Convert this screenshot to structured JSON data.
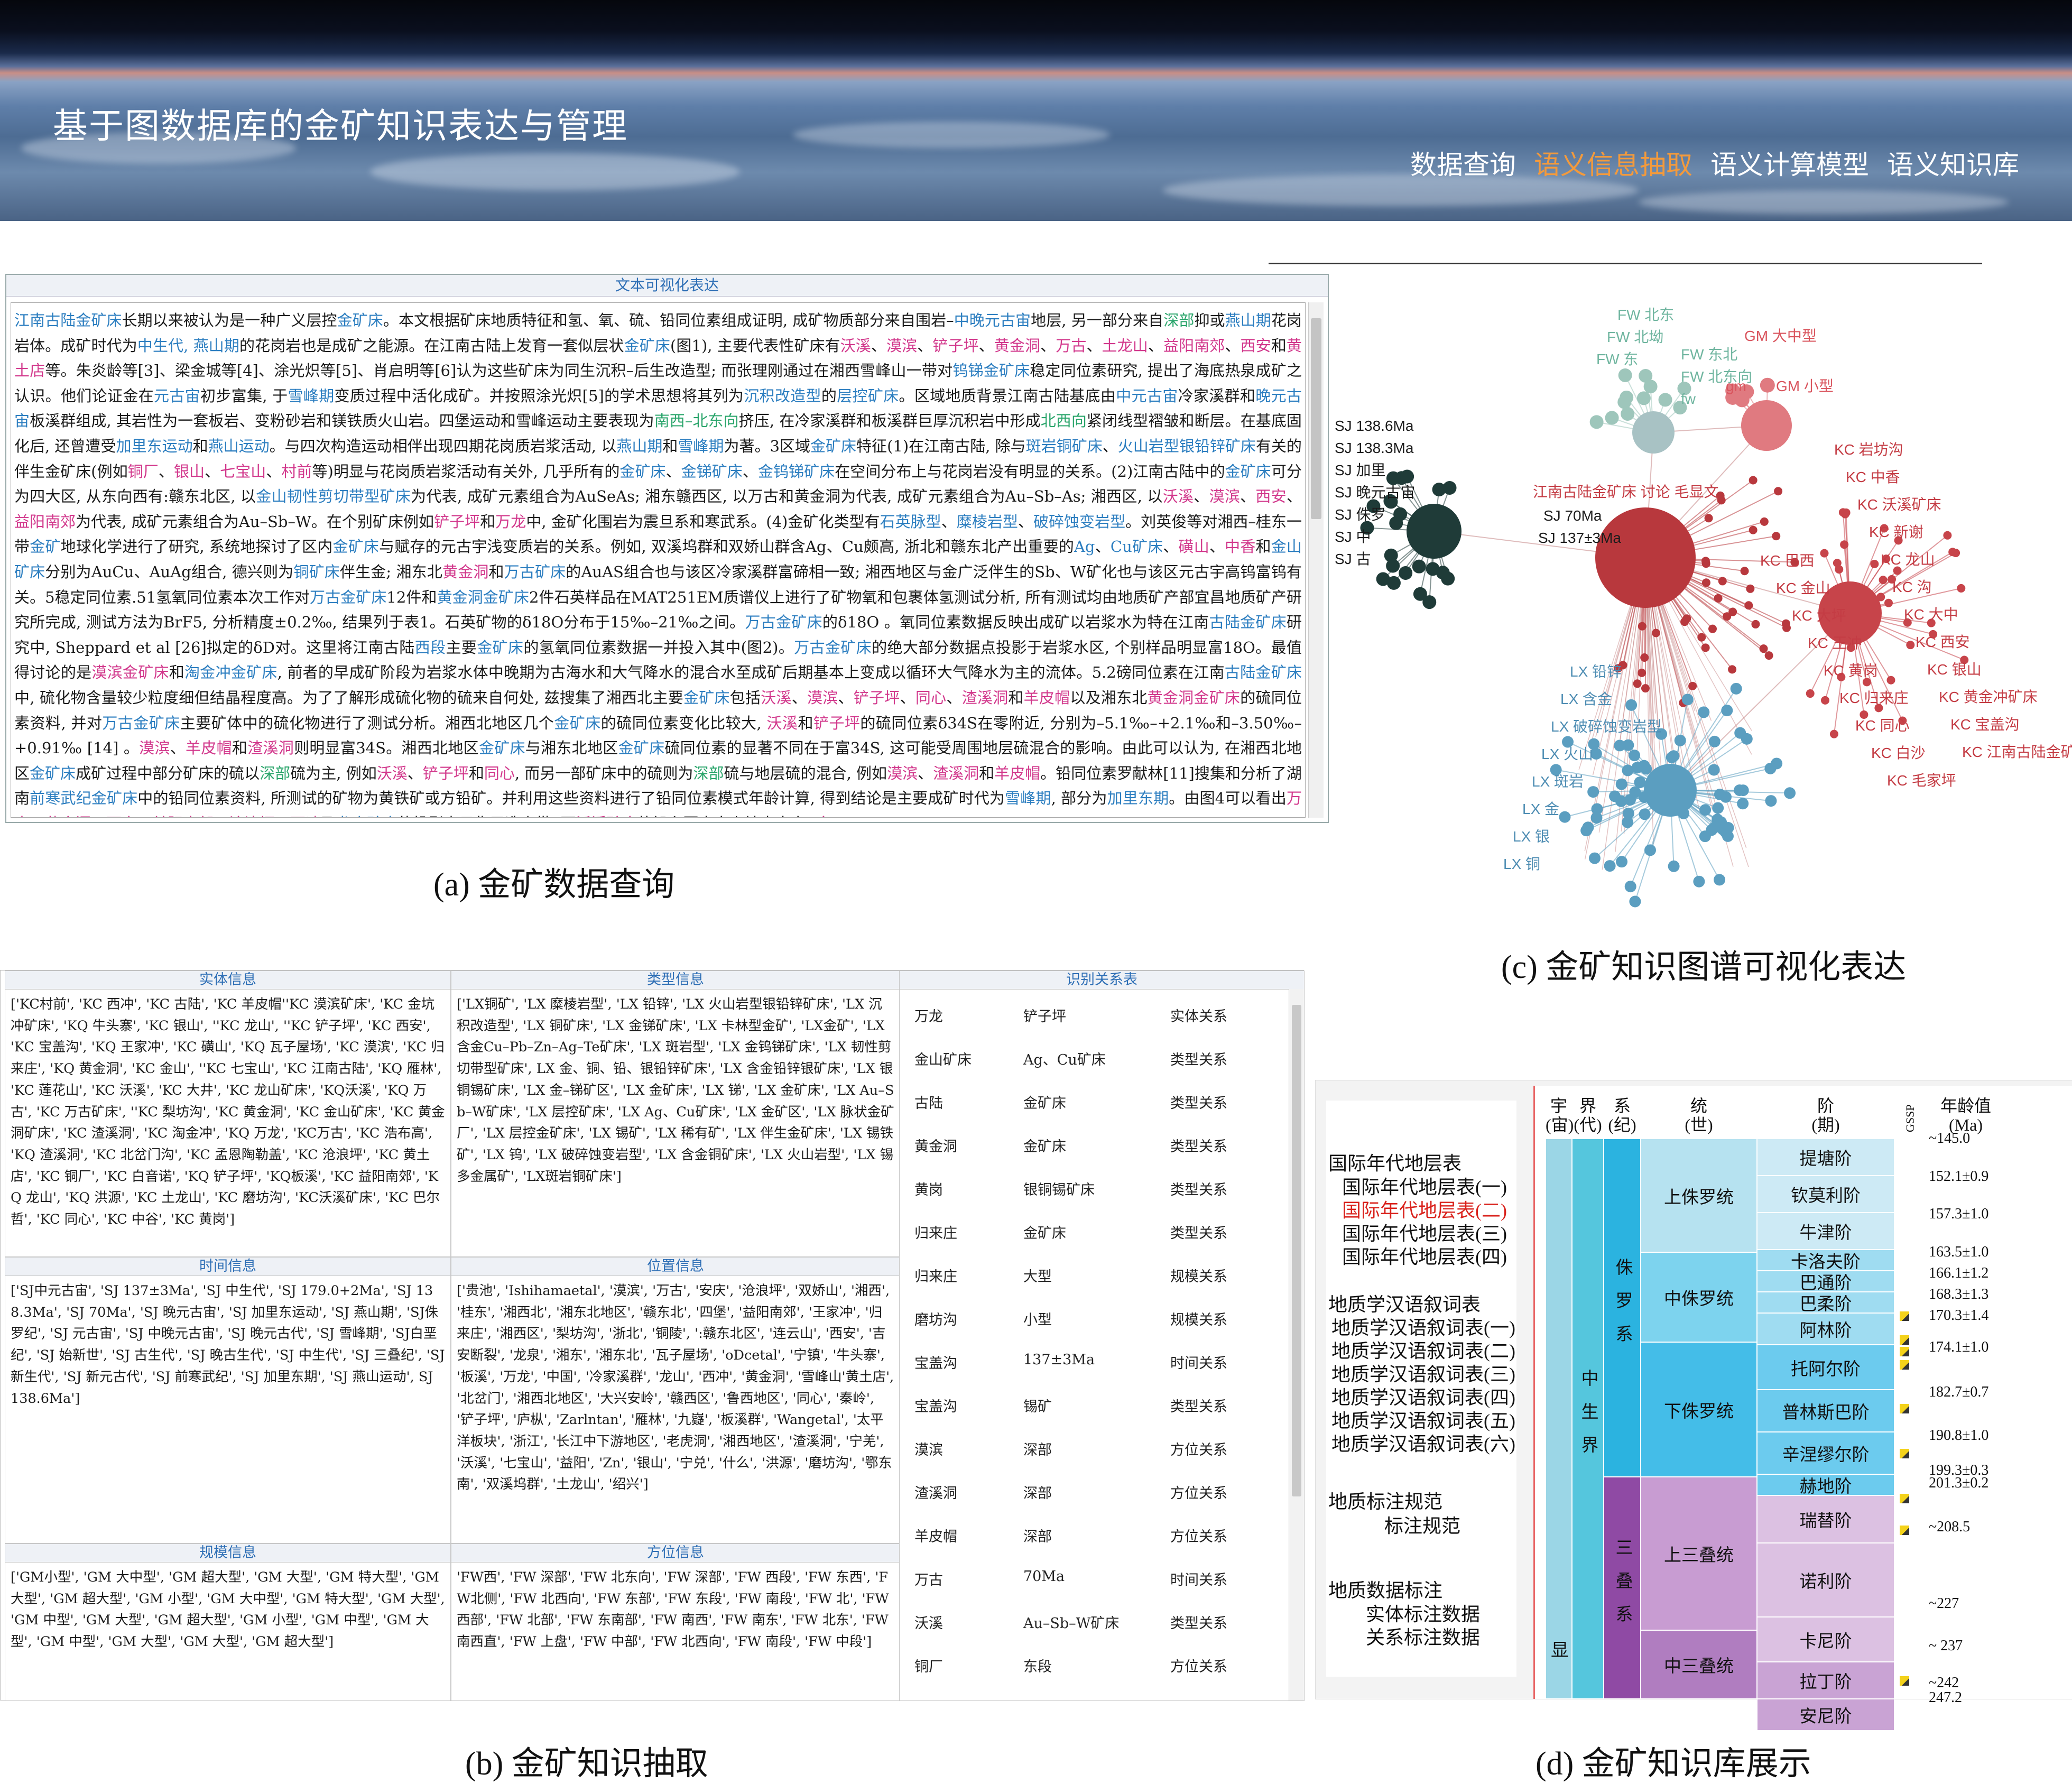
{
  "banner": {
    "title": "基于图数据库的金矿知识表达与管理",
    "nav": [
      "数据查询",
      "语义信息抽取",
      "语义计算模型",
      "语义知识库"
    ],
    "active_nav": "语义信息抽取",
    "active_color": "#f39a3c"
  },
  "captions": {
    "a": "(a) 金矿数据查询",
    "b": "(b) 金矿知识抽取",
    "c": "(c) 金矿知识图谱可视化表达",
    "d": "(d) 金矿知识库展示"
  },
  "panel_a": {
    "header": "文本可视化表达",
    "paragraph": [
      {
        "c": "b",
        "t": "江南古陆金矿床"
      },
      {
        "t": "长期以来被认为是一种广义层控"
      },
      {
        "c": "b",
        "t": "金矿床"
      },
      {
        "t": "。本文根据矿床地质特征和氢、氧、硫、铅同位素组成证明, 成矿物质部分来自围岩–"
      },
      {
        "c": "b",
        "t": "中晚元古宙"
      },
      {
        "t": "地层, 另一部分来自"
      },
      {
        "c": "g",
        "t": "深部"
      },
      {
        "t": "抑或"
      },
      {
        "c": "b",
        "t": "燕山期"
      },
      {
        "t": "花岗岩体。成矿时代为"
      },
      {
        "c": "b",
        "t": "中生代, 燕山期"
      },
      {
        "t": "的花岗岩也是成矿之能源。在江南古陆上发育一套似层状"
      },
      {
        "c": "b",
        "t": "金矿床"
      },
      {
        "t": "(图1), 主要代表性矿床有"
      },
      {
        "c": "p",
        "t": "沃溪"
      },
      {
        "t": "、"
      },
      {
        "c": "p",
        "t": "漠滨"
      },
      {
        "t": "、"
      },
      {
        "c": "p",
        "t": "铲子坪"
      },
      {
        "t": "、"
      },
      {
        "c": "p",
        "t": "黄金洞"
      },
      {
        "t": "、"
      },
      {
        "c": "p",
        "t": "万古"
      },
      {
        "t": "、"
      },
      {
        "c": "p",
        "t": "土龙山"
      },
      {
        "t": "、"
      },
      {
        "c": "p",
        "t": "益阳南郊"
      },
      {
        "t": "、"
      },
      {
        "c": "p",
        "t": "西安"
      },
      {
        "t": "和"
      },
      {
        "c": "p",
        "t": "黄土店"
      },
      {
        "t": "等。朱炎龄等[3]、梁金城等[4]、涂光炽等[5]、肖启明等[6]认为这些矿床为同生沉积–后生改造型; 而张理刚通过在湘西雪峰山一带对"
      },
      {
        "c": "b",
        "t": "钨锑金矿床"
      },
      {
        "t": "稳定同位素研究, 提出了海底热泉成矿之认识。他们论证金在"
      },
      {
        "c": "b",
        "t": "元古宙"
      },
      {
        "t": "初步富集, 于"
      },
      {
        "c": "b",
        "t": "雪峰期"
      },
      {
        "t": "变质过程中活化成矿。并按照涂光炽[5]的学术思想将其列为"
      },
      {
        "c": "b",
        "t": "沉积改造型"
      },
      {
        "t": "的"
      },
      {
        "c": "b",
        "t": "层控矿床"
      },
      {
        "t": "。区域地质背景江南古陆基底由"
      },
      {
        "c": "b",
        "t": "中元古宙"
      },
      {
        "t": "冷家溪群和"
      },
      {
        "c": "b",
        "t": "晚元古宙"
      },
      {
        "t": "板溪群组成, 其岩性为一套板岩、变粉砂岩和镁铁质火山岩。四堡运动和雪峰运动主要表现为"
      },
      {
        "c": "g",
        "t": "南西–北东向"
      },
      {
        "t": "挤压, 在冷家溪群和板溪群巨厚沉积岩中形成"
      },
      {
        "c": "g",
        "t": "北西向"
      },
      {
        "t": "紧闭线型褶皱和断层。在基底固化后, 还曾遭受"
      },
      {
        "c": "b",
        "t": "加里东运动"
      },
      {
        "t": "和"
      },
      {
        "c": "b",
        "t": "燕山运动"
      },
      {
        "t": "。与四次构造运动相伴出现四期花岗质岩浆活动, 以"
      },
      {
        "c": "b",
        "t": "燕山期"
      },
      {
        "t": "和"
      },
      {
        "c": "b",
        "t": "雪峰期"
      },
      {
        "t": "为著。3区域"
      },
      {
        "c": "b",
        "t": "金矿床"
      },
      {
        "t": "特征(1)在江南古陆, 除与"
      },
      {
        "c": "b",
        "t": "斑岩铜矿床"
      },
      {
        "t": "、"
      },
      {
        "c": "b",
        "t": "火山岩型银铅锌矿床"
      },
      {
        "t": "有关的伴生金矿床(例如"
      },
      {
        "c": "p",
        "t": "铜厂"
      },
      {
        "t": "、"
      },
      {
        "c": "p",
        "t": "银山"
      },
      {
        "t": "、"
      },
      {
        "c": "p",
        "t": "七宝山"
      },
      {
        "t": "、"
      },
      {
        "c": "p",
        "t": "村前"
      },
      {
        "t": "等)明显与花岗质岩浆活动有关外, 几乎所有的"
      },
      {
        "c": "b",
        "t": "金矿床"
      },
      {
        "t": "、"
      },
      {
        "c": "b",
        "t": "金锑矿床"
      },
      {
        "t": "、"
      },
      {
        "c": "b",
        "t": "金钨锑矿床"
      },
      {
        "t": "在空间分布上与花岗岩没有明显的关系。(2)江南古陆中的"
      },
      {
        "c": "b",
        "t": "金矿床"
      },
      {
        "t": "可分为四大区, 从东向西有:赣东北区, 以"
      },
      {
        "c": "b",
        "t": "金山韧性剪切带型矿床"
      },
      {
        "t": "为代表, 成矿元素组合为AuSeAs; 湘东赣西区, 以万古和黄金洞为代表, 成矿元素组合为Au–Sb–As; 湘西区, 以"
      },
      {
        "c": "p",
        "t": "沃溪"
      },
      {
        "t": "、"
      },
      {
        "c": "p",
        "t": "漠滨"
      },
      {
        "t": "、"
      },
      {
        "c": "p",
        "t": "西安"
      },
      {
        "t": "、"
      },
      {
        "c": "p",
        "t": "益阳南郊"
      },
      {
        "t": "为代表, 成矿元素组合为Au–Sb–W。在个别矿床例如"
      },
      {
        "c": "p",
        "t": "铲子坪"
      },
      {
        "t": "和"
      },
      {
        "c": "p",
        "t": "万龙"
      },
      {
        "t": "中, 金矿化围岩为震旦系和寒武系。(4)金矿化类型有"
      },
      {
        "c": "b",
        "t": "石英脉型"
      },
      {
        "t": "、"
      },
      {
        "c": "b",
        "t": "糜棱岩型"
      },
      {
        "t": "、"
      },
      {
        "c": "b",
        "t": "破碎蚀变岩型"
      },
      {
        "t": "。刘英俊等对湘西–桂东一带"
      },
      {
        "c": "b",
        "t": "金矿"
      },
      {
        "t": "地球化学进行了研究, 系统地探讨了区内"
      },
      {
        "c": "b",
        "t": "金矿床"
      },
      {
        "t": "与赋存的元古宇浅变质岩的关系。例如, 双溪坞群和双娇山群含Ag、Cu颇高, 浙北和赣东北产出重要的"
      },
      {
        "c": "b",
        "t": "Ag"
      },
      {
        "t": "、"
      },
      {
        "c": "b",
        "t": "Cu矿床"
      },
      {
        "t": "、"
      },
      {
        "c": "p",
        "t": "磺山"
      },
      {
        "t": "、"
      },
      {
        "c": "p",
        "t": "中香"
      },
      {
        "t": "和"
      },
      {
        "c": "b",
        "t": "金山矿床"
      },
      {
        "t": "分别为AuCu、AuAg组合, 德兴则为"
      },
      {
        "c": "b",
        "t": "铜矿床"
      },
      {
        "t": "伴生金; 湘东北"
      },
      {
        "c": "p",
        "t": "黄金洞"
      },
      {
        "t": "和"
      },
      {
        "c": "b",
        "t": "万古矿床"
      },
      {
        "t": "的AuAS组合也与该区冷家溪群富碲相一致; 湘西地区与金广泛伴生的Sb、W矿化也与该区元古宇高钨富钨有关。5稳定同位素.51氢氧同位素本次工作对"
      },
      {
        "c": "b",
        "t": "万古金矿床"
      },
      {
        "t": "12件和"
      },
      {
        "c": "b",
        "t": "黄金洞金矿床"
      },
      {
        "t": "2件石英样品在MAT251EM质谱仪上进行了矿物氧和包裹体氢测试分析, 所有测试均由地质矿产部宜昌地质矿产研究所完成, 测试方法为BrF5, 分析精度±0.2‰, 结果列于表1。石英矿物的δ18O分布于15‰–21‰之间。"
      },
      {
        "c": "b",
        "t": "万古金矿床"
      },
      {
        "t": "的δ18O 。氧同位素数据反映出成矿以岩浆水为特在江南"
      },
      {
        "c": "b",
        "t": "古陆金矿床"
      },
      {
        "t": "研究中, Sheppard et al [26]拟定的δD对。这里将江南古陆"
      },
      {
        "c": "b",
        "t": "西段"
      },
      {
        "t": "主要"
      },
      {
        "c": "b",
        "t": "金矿床"
      },
      {
        "t": "的氢氧同位素数据一并投入其中(图2)。"
      },
      {
        "c": "b",
        "t": "万古金矿床"
      },
      {
        "t": "的绝大部分数据点投影于岩浆水区, 个别样品明显富18O。最值得讨论的是"
      },
      {
        "c": "p",
        "t": "漠滨金矿床"
      },
      {
        "t": "和"
      },
      {
        "c": "b",
        "t": "淘金冲金矿床"
      },
      {
        "t": ", 前者的早成矿阶段为岩浆水体中晚期为古海水和大气降水的混合水至成矿后期基本上变成以循环大气降水为主的流体。5.2磅同位素在江南"
      },
      {
        "c": "b",
        "t": "古陆金矿床"
      },
      {
        "t": "中, 硫化物含量较少粒度细但结晶程度高。为了了解形成硫化物的硫来自何处, 兹搜集了湘西北主要"
      },
      {
        "c": "b",
        "t": "金矿床"
      },
      {
        "t": "包括"
      },
      {
        "c": "p",
        "t": "沃溪"
      },
      {
        "t": "、"
      },
      {
        "c": "p",
        "t": "漠滨"
      },
      {
        "t": "、"
      },
      {
        "c": "p",
        "t": "铲子坪"
      },
      {
        "t": "、"
      },
      {
        "c": "p",
        "t": "同心"
      },
      {
        "t": "、"
      },
      {
        "c": "p",
        "t": "渣溪洞"
      },
      {
        "t": "和"
      },
      {
        "c": "p",
        "t": "羊皮帽"
      },
      {
        "t": "以及湘东北"
      },
      {
        "c": "p",
        "t": "黄金洞金矿床"
      },
      {
        "t": "的硫同位素资料, 并对"
      },
      {
        "c": "b",
        "t": "万古金矿床"
      },
      {
        "t": "主要矿体中的硫化物进行了测试分析。湘西北地区几个"
      },
      {
        "c": "b",
        "t": "金矿床"
      },
      {
        "t": "的硫同位素变化比较大, "
      },
      {
        "c": "p",
        "t": "沃溪"
      },
      {
        "t": "和"
      },
      {
        "c": "p",
        "t": "铲子坪"
      },
      {
        "t": "的硫同位素δ34S在零附近, 分别为–5.1‰–+2.1‰和–3.50‰–+0.91‰ [14] 。"
      },
      {
        "c": "p",
        "t": "漠滨"
      },
      {
        "t": "、"
      },
      {
        "c": "p",
        "t": "羊皮帽"
      },
      {
        "t": "和"
      },
      {
        "c": "p",
        "t": "渣溪洞"
      },
      {
        "t": "则明显富34S。湘西北地区"
      },
      {
        "c": "b",
        "t": "金矿床"
      },
      {
        "t": "与湘东北地区"
      },
      {
        "c": "b",
        "t": "金矿床"
      },
      {
        "t": "硫同位素的显著不同在于富34S, 这可能受周围地层硫混合的影响。由此可以认为, 在湘西北地区"
      },
      {
        "c": "b",
        "t": "金矿床"
      },
      {
        "t": "成矿过程中部分矿床的硫以"
      },
      {
        "c": "g",
        "t": "深部"
      },
      {
        "t": "硫为主, 例如"
      },
      {
        "c": "p",
        "t": "沃溪"
      },
      {
        "t": "、"
      },
      {
        "c": "p",
        "t": "铲子坪"
      },
      {
        "t": "和"
      },
      {
        "c": "p",
        "t": "同心"
      },
      {
        "t": ", 而另一部矿床中的硫则为"
      },
      {
        "c": "g",
        "t": "深部"
      },
      {
        "t": "硫与地层硫的混合, 例如"
      },
      {
        "c": "p",
        "t": "漠滨"
      },
      {
        "t": "、"
      },
      {
        "c": "p",
        "t": "渣溪洞"
      },
      {
        "t": "和"
      },
      {
        "c": "p",
        "t": "羊皮帽"
      },
      {
        "t": "。铅同位素罗献林[11]搜集和分析了湖南"
      },
      {
        "c": "b",
        "t": "前寒武纪金矿床"
      },
      {
        "t": "中的铅同位素资料, 所测试的矿物为黄铁矿或方铅矿。并利用这些资料进行了铅同位素模式年龄计算, 得到结论是主要成矿时代为"
      },
      {
        "c": "b",
        "t": "雪峰期"
      },
      {
        "t": ", 部分为"
      },
      {
        "c": "b",
        "t": "加里东期"
      },
      {
        "t": "。由图4可以看出"
      },
      {
        "c": "p",
        "t": "万古"
      },
      {
        "t": "、"
      },
      {
        "c": "p",
        "t": "黄金洞"
      },
      {
        "t": "、"
      },
      {
        "c": "p",
        "t": "西安"
      },
      {
        "t": "、"
      },
      {
        "c": "p",
        "t": "益阳南郊"
      },
      {
        "t": "、"
      },
      {
        "c": "p",
        "t": "沧浪坪"
      },
      {
        "t": "、"
      },
      {
        "c": "p",
        "t": "西冲"
      },
      {
        "t": "及"
      },
      {
        "c": "b",
        "t": "龙山矿床"
      },
      {
        "t": "的投影点云集于造山带, 而"
      },
      {
        "c": "p",
        "t": "沃溪矿床"
      },
      {
        "t": "的铅主要来自上地壳本身, "
      },
      {
        "c": "p",
        "t": "金"
      }
    ],
    "colors": {
      "b": "#2c7ec0",
      "p": "#d2388c",
      "g": "#2aa56b"
    }
  },
  "panel_c": {
    "colors": {
      "time": "#1f3b38",
      "scale": "#e07a80",
      "fw": "#9ec6bb",
      "gold": "#b8383d",
      "gold2": "#c7444a",
      "lx": "#5b9ec0",
      "center_gray": "#a8c2c4"
    },
    "labels_dark": [
      "SJ 138.6Ma",
      "SJ 138.3Ma",
      "SJ 加里",
      "SJ 晚元古宙",
      "SJ 侏罗",
      "SJ 中",
      "SJ 古",
      "SJ 70Ma",
      "SJ 137±3Ma"
    ],
    "labels_fw": [
      "FW 北东",
      "FW 北坳",
      "FW 东",
      "FW 东北",
      "FW 北东向",
      "fw"
    ],
    "labels_gm": [
      "GM 大中型",
      "gm",
      "GM 小型",
      "GM 大型"
    ],
    "labels_kc": [
      "KC 岩坊沟",
      "KC 中香",
      "KC 沃溪矿床",
      "KC 新谢",
      "KC 龙山",
      "KC 沟",
      "KC 大中",
      "KC 西安",
      "KC 银山",
      "KC 黄金冲矿床",
      "KC 宝盖沟",
      "KC 江南古陆金矿床",
      "KC 巴西",
      "KC 金山",
      "KC 大坪",
      "KC 王冲",
      "KC 黄岗",
      "KC 归来庄",
      "KC 同心",
      "KC 白沙",
      "KC 毛家坪"
    ],
    "labels_lx": [
      "LX 铅锌",
      "LX 含金",
      "LX 破碎蚀变岩型",
      "LX 火山",
      "LX 斑岩",
      "LX 金",
      "LX 银",
      "LX 铜"
    ],
    "label_misc": "江南古陆金矿床 讨论 毛显文"
  },
  "panel_b": {
    "entity": {
      "header": "实体信息",
      "text": "['KC村前', 'KC 西冲', 'KC 古陆', 'KC 羊皮帽''KC 漠滨矿床', 'KC 金坑冲矿床', 'KQ 牛头寨', 'KC 银山', ''KC 龙山', ''KC 铲子坪', 'KC 西安', 'KC 宝盖沟', 'KQ 王家冲', 'KC 磺山', 'KQ 瓦子屋场', 'KC 漠滨', 'KC 归来庄', 'KQ 黄金洞', 'KC 金山', ''KC 七宝山', 'KC 江南古陆', 'KQ 雁林', 'KC 莲花山', 'KC 沃溪', 'KC 大井', 'KC 龙山矿床', 'KQ沃溪', 'KQ 万古', 'KC 万古矿床', ''KC 梨坊沟', 'KC 黄金洞', 'KC 金山矿床', 'KC 黄金洞矿床', 'KC 渣溪洞', 'KC 淘金冲', 'KQ 万龙', 'KC万古', 'KC 浩布高', 'KQ 渣溪洞', 'KC 北岔门沟', 'KC 孟恩陶勒盖', 'KC 沧浪坪', 'KC 黄土店', 'KC 铜厂', 'KC 白音诺', 'KQ 铲子坪', 'KQ板溪', 'KC 益阳南郊', 'KQ 龙山', 'KQ 洪源', 'KC 土龙山', 'KC 磨坊沟', 'KC沃溪矿床', 'KC 巴尔哲', 'KC 同心', 'KC 中谷', 'KC 黄岗']"
    },
    "type": {
      "header": "类型信息",
      "text": "['LX铜矿', 'LX 糜棱岩型', 'LX 铅锌', 'LX 火山岩型银铅锌矿床', 'LX 沉积改造型', 'LX 铜矿床', 'LX 金锑矿床', 'LX 卡林型金矿', 'LX金矿', 'LX 含金Cu–Pb–Zn–Ag–Te矿床', 'LX 斑岩型', 'LX 金钨锑矿床', 'LX 韧性剪切带型矿床', LX 金、铜、铅、银铅锌矿床', 'LX 含金铅锌银矿床', 'LX 银铜锡矿床', 'LX 金–锑矿区', 'LX 金矿床', 'LX 锑', 'LX 金矿床', 'LX Au–Sb–W矿床', 'LX 层控矿床', 'LX Ag、Cu矿床', 'LX 金矿区', 'LX 脉状金矿厂', 'LX 层控金矿床', 'LX 锡矿', 'LX 稀有矿', 'LX 伴生金矿床', 'LX 锡铁矿', 'LX 钨', 'LX 破碎蚀变岩型', 'LX 含金铜矿床', 'LX 火山岩型', 'LX 锡多金属矿', 'LX斑岩铜矿床']"
    },
    "time": {
      "header": "时间信息",
      "text": "['SJ中元古宙', 'SJ 137±3Ma', 'SJ 中生代', 'SJ 179.0+2Ma', 'SJ 138.3Ma', 'SJ 70Ma', 'SJ 晚元古宙', 'SJ 加里东运动', 'SJ 燕山期', 'SJ侏罗纪', 'SJ 元古宙', 'SJ 中晚元古宙', 'SJ 晚元古代', 'SJ 雪峰期', 'SJ白垩纪', 'SJ 始新世', 'SJ 古生代', 'SJ 晚古生代', 'SJ 中生代', 'SJ 三叠纪', 'SJ 新生代', 'SJ 新元古代', 'SJ 前寒武纪', 'SJ 加里东期', 'SJ 燕山运动', SJ 138.6Ma']"
    },
    "location": {
      "header": "位置信息",
      "text": "['贵池', 'Ishihamaetal', '漠滨', '万古', '安庆', '沧浪坪', '双娇山', '湘西', '桂东', '湘西北', '湘东北地区', '赣东北', '四堡', '益阳南郊', '王家冲', '归来庄', '湘西区', '梨坊沟', '浙北', '铜陵', ':赣东北区', '连云山', '西安', '吉安断裂', '龙泉', '湘东', '湘东北', '瓦子屋场', 'oDcetal', '宁镇', '牛头寨', '板溪', '万龙', '中国', '冷家溪群', '龙山', '西冲', '黄金洞', '雪峰山'黄土店', '北岔门', '湘西北地区', '大兴安岭', '赣西区', '鲁西地区', '同心', '秦岭', '铲子坪', '庐枞', 'Zarlntan', '雁林', '九嶷', '板溪群', 'Wangetal', '太平洋板块', '浙江', '长江中下游地区', '老虎洞', '湘西地区', '渣溪洞', '宁羌', '沃溪', '七宝山', '益阳', 'Zn', '银山', '宁兑', '什么', '洪源', '磨坊沟', '鄂东南', '双溪坞群', '土龙山', '绍兴']"
    },
    "scale": {
      "header": "规模信息",
      "text": "['GM小型', 'GM 大中型', 'GM 超大型', 'GM 大型', 'GM 特大型', 'GM大型', 'GM 超大型', 'GM 小型', 'GM 大中型', 'GM 特大型', 'GM 大型', 'GM 中型', 'GM 大型', 'GM 超大型', 'GM 小型', 'GM 中型', 'GM 大型', 'GM 中型', 'GM 大型', 'GM 大型', 'GM 超大型']"
    },
    "direction": {
      "header": "方位信息",
      "text": "'FW西', 'FW 深部', 'FW 北东向', 'FW 深部', 'FW 西段', 'FW 东西', 'FW北侧', 'FW 北西向', 'FW 东部', 'FW 东段', 'FW 南段', 'FW 北', 'FW西部', 'FW 北部', 'FW 东南部', 'FW 南西', 'FW 南东', 'FW 北东', 'FW南西直', 'FW 上盘', 'FW 中部', 'FW 北西向', 'FW 南段', 'FW 中段']"
    },
    "relations": {
      "header": "识别关系表",
      "rows": [
        [
          "万龙",
          "铲子坪",
          "实体关系"
        ],
        [
          "金山矿床",
          "Ag、Cu矿床",
          "类型关系"
        ],
        [
          "古陆",
          "金矿床",
          "类型关系"
        ],
        [
          "黄金洞",
          "金矿床",
          "类型关系"
        ],
        [
          "黄岗",
          "银铜锡矿床",
          "类型关系"
        ],
        [
          "归来庄",
          "金矿床",
          "类型关系"
        ],
        [
          "归来庄",
          "大型",
          "规模关系"
        ],
        [
          "磨坊沟",
          "小型",
          "规模关系"
        ],
        [
          "宝盖沟",
          "137±3Ma",
          "时间关系"
        ],
        [
          "宝盖沟",
          "锡矿",
          "类型关系"
        ],
        [
          "漠滨",
          "深部",
          "方位关系"
        ],
        [
          "渣溪洞",
          "深部",
          "方位关系"
        ],
        [
          "羊皮帽",
          "深部",
          "方位关系"
        ],
        [
          "万古",
          "70Ma",
          "时间关系"
        ],
        [
          "沃溪",
          "Au–Sb–W矿床",
          "类型关系"
        ],
        [
          "铜厂",
          "东段",
          "方位关系"
        ]
      ]
    }
  },
  "panel_d": {
    "nav": {
      "g1": "国际年代地层表",
      "g1_items": [
        "国际年代地层表(一)",
        "国际年代地层表(二)",
        "国际年代地层表(三)",
        "国际年代地层表(四)"
      ],
      "g1_active": "国际年代地层表(二)",
      "g2": "地质学汉语叙词表",
      "g2_items": [
        "地质学汉语叙词表(一)",
        "地质学汉语叙词表(二)",
        "地质学汉语叙词表(三)",
        "地质学汉语叙词表(四)",
        "地质学汉语叙词表(五)",
        "地质学汉语叙词表(六)"
      ],
      "g3": "地质标注规范",
      "g3_items": [
        "标注规范"
      ],
      "g4": "地质数据标注",
      "g4_items": [
        "实体标注数据",
        "关系标注数据"
      ]
    },
    "table": {
      "headers": [
        {
          "line1": "宇",
          "line2": "(宙)"
        },
        {
          "line1": "界",
          "line2": "(代)"
        },
        {
          "line1": "系",
          "line2": "(纪)"
        },
        {
          "line1": "统",
          "line2": "(世)"
        },
        {
          "line1": "阶",
          "line2": "(期)"
        },
        {
          "line1": "GSSP",
          "line2": ""
        },
        {
          "line1": "年龄值",
          "line2": "(Ma)"
        }
      ],
      "eon": "显",
      "era": "中生界",
      "systems": [
        "侏罗系",
        "三叠系"
      ],
      "series": [
        "上侏罗统",
        "中侏罗统",
        "下侏罗统",
        "上三叠统",
        "中三叠统"
      ],
      "stages": [
        "提塘阶",
        "钦莫利阶",
        "牛津阶",
        "卡洛夫阶",
        "巴通阶",
        "巴柔阶",
        "阿林阶",
        "托阿尔阶",
        "普林斯巴阶",
        "辛涅缪尔阶",
        "赫地阶",
        "瑞替阶",
        "诺利阶",
        "卡尼阶",
        "拉丁阶",
        "安尼阶"
      ],
      "ages": [
        "~145.0",
        "152.1±0.9",
        "157.3±1.0",
        "163.5±1.0",
        "166.1±1.2",
        "168.3±1.3",
        "170.3±1.4",
        "174.1±1.0",
        "182.7±0.7",
        "190.8±1.0",
        "199.3±0.3",
        "201.3±0.2",
        "~208.5",
        "~227",
        "~ 237",
        "~242",
        "247.2"
      ],
      "colors": {
        "eon": "#9bd6e6",
        "era": "#55c6dd",
        "jura": "#2bb3e0",
        "jura_upper": "#b6e2f0",
        "jura_middle": "#7dd3ee",
        "jura_lower": "#44bde8",
        "stage_upper": "#cdeaf5",
        "stage_middle": "#9fdcf1",
        "stage_lower": "#6ccbee",
        "tri": "#8f4aa4",
        "tri_upper": "#c89cd2",
        "tri_middle": "#b07dc0",
        "stage_tri": "#dcc1e2",
        "stage_tri_mid": "#c9a3d4",
        "gssp": "#f4d21a"
      }
    }
  }
}
